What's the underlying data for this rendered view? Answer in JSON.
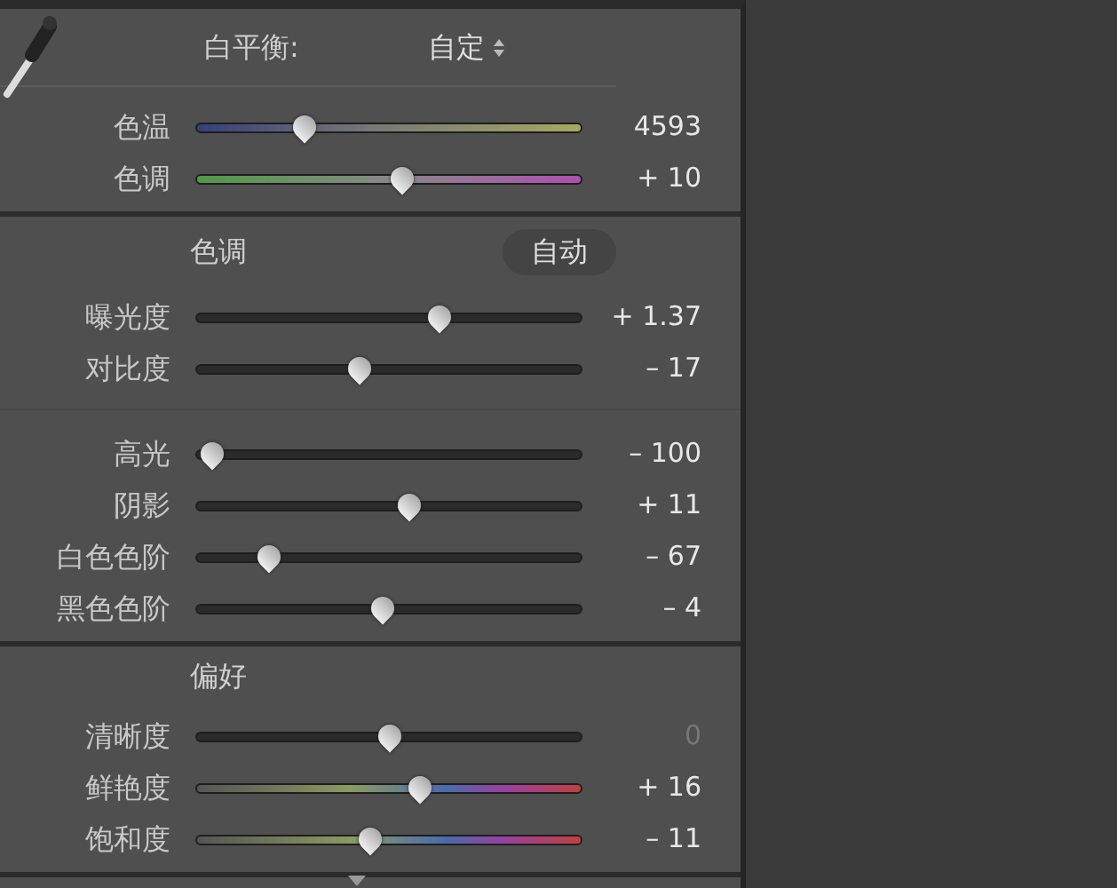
{
  "sections": [
    {
      "kind": "white_balance",
      "title": "白平衡:",
      "control": {
        "kind": "dropdown",
        "label": "自定"
      },
      "groups": [
        [
          {
            "label": "色温",
            "kind": "temperature",
            "level": 0.28,
            "reading": "4593",
            "dimmed": false
          },
          {
            "label": "色调",
            "kind": "tint",
            "level": 0.53,
            "reading": "+ 10",
            "dimmed": false
          }
        ]
      ]
    },
    {
      "kind": "tone",
      "title": "色调",
      "control": {
        "kind": "button",
        "label": "自动"
      },
      "groups": [
        [
          {
            "label": "曝光度",
            "kind": "plain",
            "level": 0.63,
            "reading": "+ 1.37",
            "dimmed": false
          },
          {
            "label": "对比度",
            "kind": "plain",
            "level": 0.42,
            "reading": "– 17",
            "dimmed": false
          }
        ],
        [
          {
            "label": "高光",
            "kind": "plain",
            "level": 0.04,
            "reading": "– 100",
            "dimmed": false
          },
          {
            "label": "阴影",
            "kind": "plain",
            "level": 0.55,
            "reading": "+ 11",
            "dimmed": false
          },
          {
            "label": "白色色阶",
            "kind": "plain",
            "level": 0.19,
            "reading": "– 67",
            "dimmed": false
          },
          {
            "label": "黑色色阶",
            "kind": "plain",
            "level": 0.48,
            "reading": "– 4",
            "dimmed": false
          }
        ]
      ]
    },
    {
      "kind": "presence",
      "title": "偏好",
      "groups": [
        [
          {
            "label": "清晰度",
            "kind": "plain",
            "level": 0.5,
            "reading": "0",
            "dimmed": true
          },
          {
            "label": "鲜艳度",
            "kind": "saturation",
            "level": 0.58,
            "reading": "+ 16",
            "dimmed": false
          },
          {
            "label": "饱和度",
            "kind": "saturation",
            "level": 0.45,
            "reading": "– 11",
            "dimmed": false
          }
        ]
      ]
    }
  ]
}
